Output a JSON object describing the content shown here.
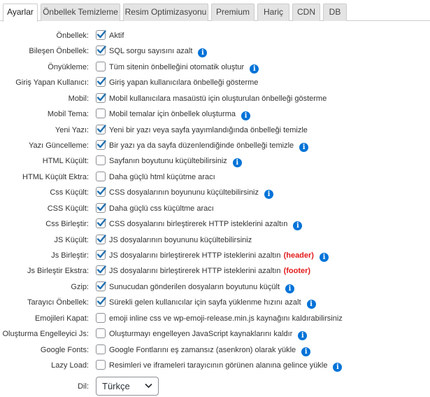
{
  "tabs": [
    {
      "label": "Ayarlar",
      "active": true
    },
    {
      "label": "Önbellek Temizleme",
      "active": false
    },
    {
      "label": "Resim Optimizasyonu",
      "active": false
    },
    {
      "label": "Premium",
      "active": false
    },
    {
      "label": "Hariç",
      "active": false
    },
    {
      "label": "CDN",
      "active": false
    },
    {
      "label": "DB",
      "active": false
    }
  ],
  "settings": [
    {
      "label": "Önbellek:",
      "text": "Aktif",
      "checked": true,
      "info": false
    },
    {
      "label": "Bileşen Önbellek:",
      "text": "SQL sorgu sayısını azalt",
      "checked": true,
      "info": true
    },
    {
      "label": "Önyükleme:",
      "text": "Tüm sitenin önbelleğini otomatik oluştur",
      "checked": false,
      "info": true
    },
    {
      "label": "Giriş Yapan Kullanıcı:",
      "text": "Giriş yapan kullanıcılara önbelleği gösterme",
      "checked": true,
      "info": false
    },
    {
      "label": "Mobil:",
      "text": "Mobil kullanıcılara masaüstü için oluşturulan önbelleği gösterme",
      "checked": true,
      "info": false
    },
    {
      "label": "Mobil Tema:",
      "text": "Mobil temalar için önbellek oluşturma",
      "checked": false,
      "info": true
    },
    {
      "label": "Yeni Yazı:",
      "text": "Yeni bir yazı veya sayfa yayımlandığında önbelleği temizle",
      "checked": true,
      "info": false
    },
    {
      "label": "Yazı Güncelleme:",
      "text": "Bir yazı ya da sayfa düzenlendiğinde önbelleği temizle",
      "checked": true,
      "info": true
    },
    {
      "label": "HTML Küçült:",
      "text": "Sayfanın boyutunu küçültebilirsiniz",
      "checked": false,
      "info": true
    },
    {
      "label": "HTML Küçült Ektra:",
      "text": "Daha güçlü html küçütme aracı",
      "checked": false,
      "info": false
    },
    {
      "label": "Css Küçült:",
      "text": "CSS dosyalarının boyununu küçültebilirsiniz",
      "checked": true,
      "info": true
    },
    {
      "label": "CSS Küçült:",
      "text": "Daha güçlü css küçültme aracı",
      "checked": true,
      "info": false
    },
    {
      "label": "Css Birleştir:",
      "text": "CSS dosyalarını birleştirerek HTTP isteklerini azaltın",
      "checked": true,
      "info": true
    },
    {
      "label": "JS Küçült:",
      "text": "JS dosyalarının boyununu küçültebilirsiniz",
      "checked": true,
      "info": false
    },
    {
      "label": "Js Birleştir:",
      "text": "JS dosyalarını birleştirerek HTTP isteklerini azaltın",
      "highlight": "(header)",
      "checked": true,
      "info": true
    },
    {
      "label": "Js Birleştir Ekstra:",
      "text": "JS dosyalarını birleştirerek HTTP isteklerini azaltın",
      "highlight": "(footer)",
      "checked": true,
      "info": false
    },
    {
      "label": "Gzip:",
      "text": "Sunucudan gönderilen dosyaların boyutunu küçült",
      "checked": true,
      "info": true
    },
    {
      "label": "Tarayıcı Önbellek:",
      "text": "Sürekli gelen kullanıcılar için sayfa yüklenme hızını azalt",
      "checked": true,
      "info": true
    },
    {
      "label": "Emojileri Kapat:",
      "text": "emoji inline css ve wp-emoji-release.min.js kaynağını kaldırabilirsiniz",
      "checked": false,
      "info": false
    },
    {
      "label": "Oluşturma Engelleyici Js:",
      "text": "Oluşturmayı engelleyen JavaScript kaynaklarını kaldır",
      "checked": false,
      "info": true
    },
    {
      "label": "Google Fonts:",
      "text": "Google Fontlarını eş zamansız (asenkron) olarak yükle",
      "checked": false,
      "info": true
    },
    {
      "label": "Lazy Load:",
      "text": "Resimleri ve iframeleri tarayıcının görünen alanına gelince yükle",
      "checked": false,
      "info": true
    }
  ],
  "language": {
    "label": "Dil:",
    "selected": "Türkçe"
  },
  "colors": {
    "accent": "#0073d8",
    "highlight": "#e21b1b",
    "checkmark": "#2271b1"
  }
}
